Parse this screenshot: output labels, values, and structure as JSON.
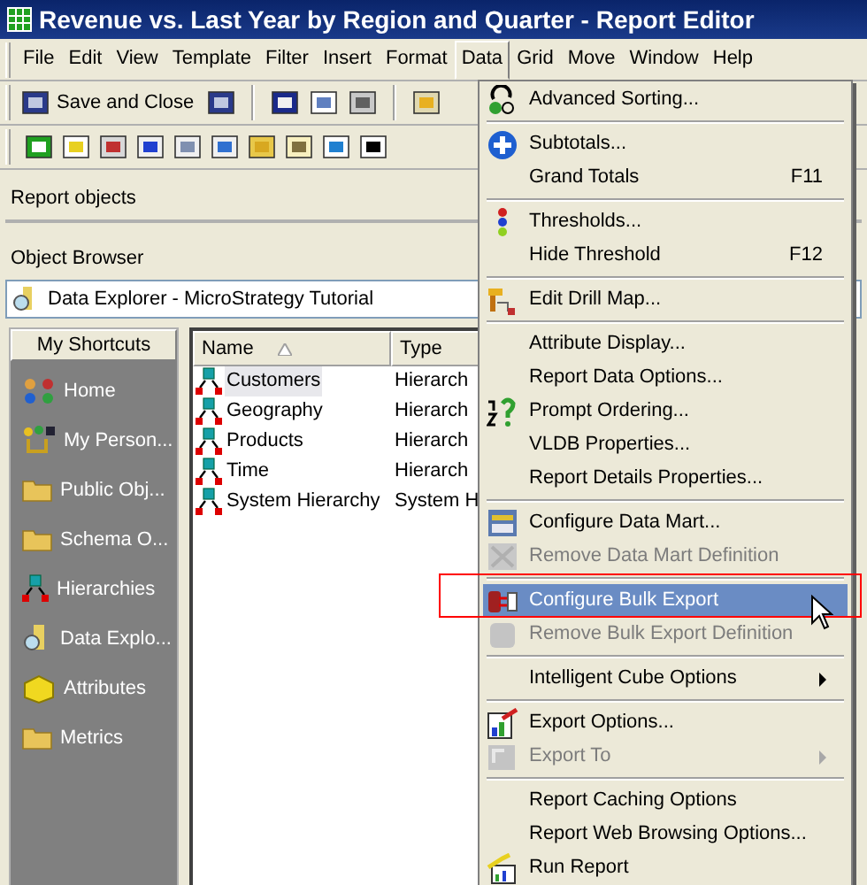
{
  "window": {
    "title": "Revenue vs. Last Year by Region and Quarter - Report Editor"
  },
  "menu_bar": [
    {
      "label": "File",
      "selected": false
    },
    {
      "label": "Edit",
      "selected": false
    },
    {
      "label": "View",
      "selected": false
    },
    {
      "label": "Template",
      "selected": false
    },
    {
      "label": "Filter",
      "selected": false
    },
    {
      "label": "Insert",
      "selected": false
    },
    {
      "label": "Format",
      "selected": false
    },
    {
      "label": "Data",
      "selected": true
    },
    {
      "label": "Grid",
      "selected": false
    },
    {
      "label": "Move",
      "selected": false
    },
    {
      "label": "Window",
      "selected": false
    },
    {
      "label": "Help",
      "selected": false
    }
  ],
  "toolbar": {
    "save_and_close": "Save and Close"
  },
  "report_objects": {
    "title": "Report objects"
  },
  "object_browser": {
    "title": "Object Browser",
    "location": "Data Explorer - MicroStrategy Tutorial"
  },
  "shortcuts": {
    "title": "My Shortcuts",
    "items": [
      {
        "label": "Home"
      },
      {
        "label": "My Person..."
      },
      {
        "label": "Public Obj..."
      },
      {
        "label": "Schema O..."
      },
      {
        "label": "Hierarchies"
      },
      {
        "label": "Data Explo..."
      },
      {
        "label": "Attributes"
      },
      {
        "label": "Metrics"
      }
    ]
  },
  "listing": {
    "columns": [
      "Name",
      "Type"
    ],
    "rows": [
      {
        "name": "Customers",
        "type": "Hierarch",
        "selected": true
      },
      {
        "name": "Geography",
        "type": "Hierarch",
        "selected": false
      },
      {
        "name": "Products",
        "type": "Hierarch",
        "selected": false
      },
      {
        "name": "Time",
        "type": "Hierarch",
        "selected": false
      },
      {
        "name": "System Hierarchy",
        "type": "System H",
        "selected": false
      }
    ]
  },
  "data_menu": [
    {
      "kind": "item",
      "label": "Advanced Sorting...",
      "disabled": false,
      "selected": false
    },
    {
      "kind": "separator"
    },
    {
      "kind": "item",
      "label": "Subtotals...",
      "disabled": false,
      "selected": false
    },
    {
      "kind": "item",
      "label": "Grand Totals",
      "shortcut": "F11",
      "disabled": false,
      "selected": false
    },
    {
      "kind": "separator"
    },
    {
      "kind": "item",
      "label": "Thresholds...",
      "disabled": false,
      "selected": false
    },
    {
      "kind": "item",
      "label": "Hide Threshold",
      "shortcut": "F12",
      "disabled": false,
      "selected": false
    },
    {
      "kind": "separator"
    },
    {
      "kind": "item",
      "label": "Edit Drill Map...",
      "disabled": false,
      "selected": false
    },
    {
      "kind": "separator"
    },
    {
      "kind": "item",
      "label": "Attribute Display...",
      "disabled": false,
      "selected": false
    },
    {
      "kind": "item",
      "label": "Report Data Options...",
      "disabled": false,
      "selected": false
    },
    {
      "kind": "item",
      "label": "Prompt Ordering...",
      "disabled": false,
      "selected": false
    },
    {
      "kind": "item",
      "label": "VLDB Properties...",
      "disabled": false,
      "selected": false
    },
    {
      "kind": "item",
      "label": "Report Details Properties...",
      "disabled": false,
      "selected": false
    },
    {
      "kind": "separator"
    },
    {
      "kind": "item",
      "label": "Configure Data Mart...",
      "disabled": false,
      "selected": false
    },
    {
      "kind": "item",
      "label": "Remove Data Mart Definition",
      "disabled": true,
      "selected": false
    },
    {
      "kind": "separator"
    },
    {
      "kind": "item",
      "label": "Configure Bulk Export",
      "disabled": false,
      "selected": true
    },
    {
      "kind": "item",
      "label": "Remove Bulk Export Definition",
      "disabled": true,
      "selected": false
    },
    {
      "kind": "separator"
    },
    {
      "kind": "submenu",
      "label": "Intelligent Cube Options",
      "disabled": false,
      "selected": false
    },
    {
      "kind": "separator"
    },
    {
      "kind": "item",
      "label": "Export Options...",
      "disabled": false,
      "selected": false
    },
    {
      "kind": "submenu",
      "label": "Export To",
      "disabled": true,
      "selected": false
    },
    {
      "kind": "separator"
    },
    {
      "kind": "item",
      "label": "Report Caching Options",
      "disabled": false,
      "selected": false
    },
    {
      "kind": "item",
      "label": "Report Web Browsing Options...",
      "disabled": false,
      "selected": false
    },
    {
      "kind": "item",
      "label": "Run Report",
      "disabled": false,
      "selected": false
    }
  ]
}
